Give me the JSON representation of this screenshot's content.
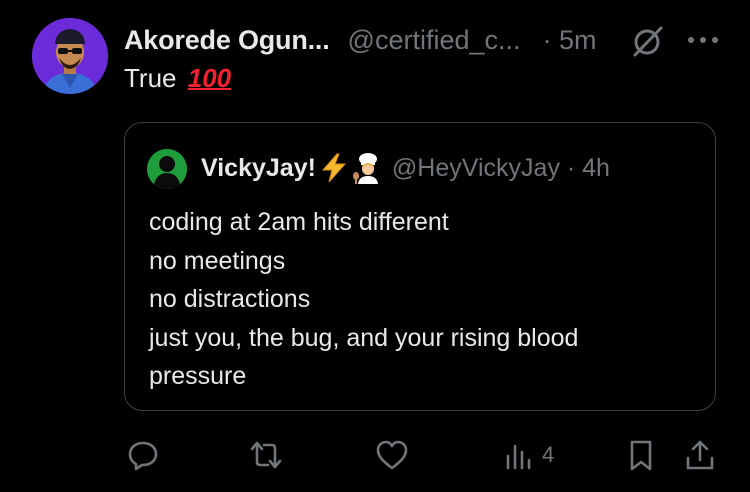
{
  "post": {
    "author_name": "Akorede Ogun...",
    "author_handle": "@certified_c...",
    "time": "· 5m",
    "text": "True",
    "emoji": "100"
  },
  "quote": {
    "author_name": "VickyJay!",
    "handle_time": "@HeyVickyJay · 4h",
    "lines": [
      "coding at 2am hits different",
      "no meetings",
      "no distractions",
      "just you, the bug, and your rising blood",
      "pressure"
    ]
  },
  "actions": {
    "views_count": "4"
  },
  "colors": {
    "background": "#000000",
    "primary_text": "#e7e9ea",
    "secondary_text": "#71767b",
    "border": "#3e4144",
    "avatar_bg": "#6b2bd9",
    "emoji_red": "#f4212e"
  },
  "icons": [
    "grok-icon",
    "more-icon",
    "reply-icon",
    "repost-icon",
    "like-icon",
    "views-icon",
    "bookmark-icon",
    "share-icon"
  ]
}
